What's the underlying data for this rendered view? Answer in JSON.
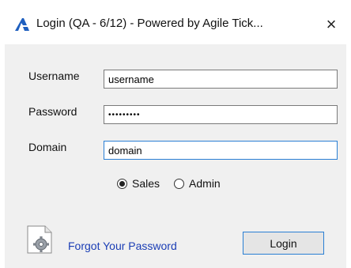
{
  "window": {
    "title": "Login (QA - 6/12) - Powered by Agile Tick...",
    "close_glyph": "×",
    "app_icon": "agile-logo-icon"
  },
  "form": {
    "username_label": "Username",
    "username_value": "username",
    "password_label": "Password",
    "password_value": "•••••••••",
    "domain_label": "Domain",
    "domain_value": "domain"
  },
  "role": {
    "options": [
      "Sales",
      "Admin"
    ],
    "selected": "Sales"
  },
  "footer": {
    "gear_icon": "gear-icon",
    "forgot_link": "Forgot Your Password",
    "login_label": "Login"
  },
  "colors": {
    "link": "#1a3db5",
    "focus_border": "#2a7fd4",
    "panel_bg": "#f0f0f0"
  }
}
